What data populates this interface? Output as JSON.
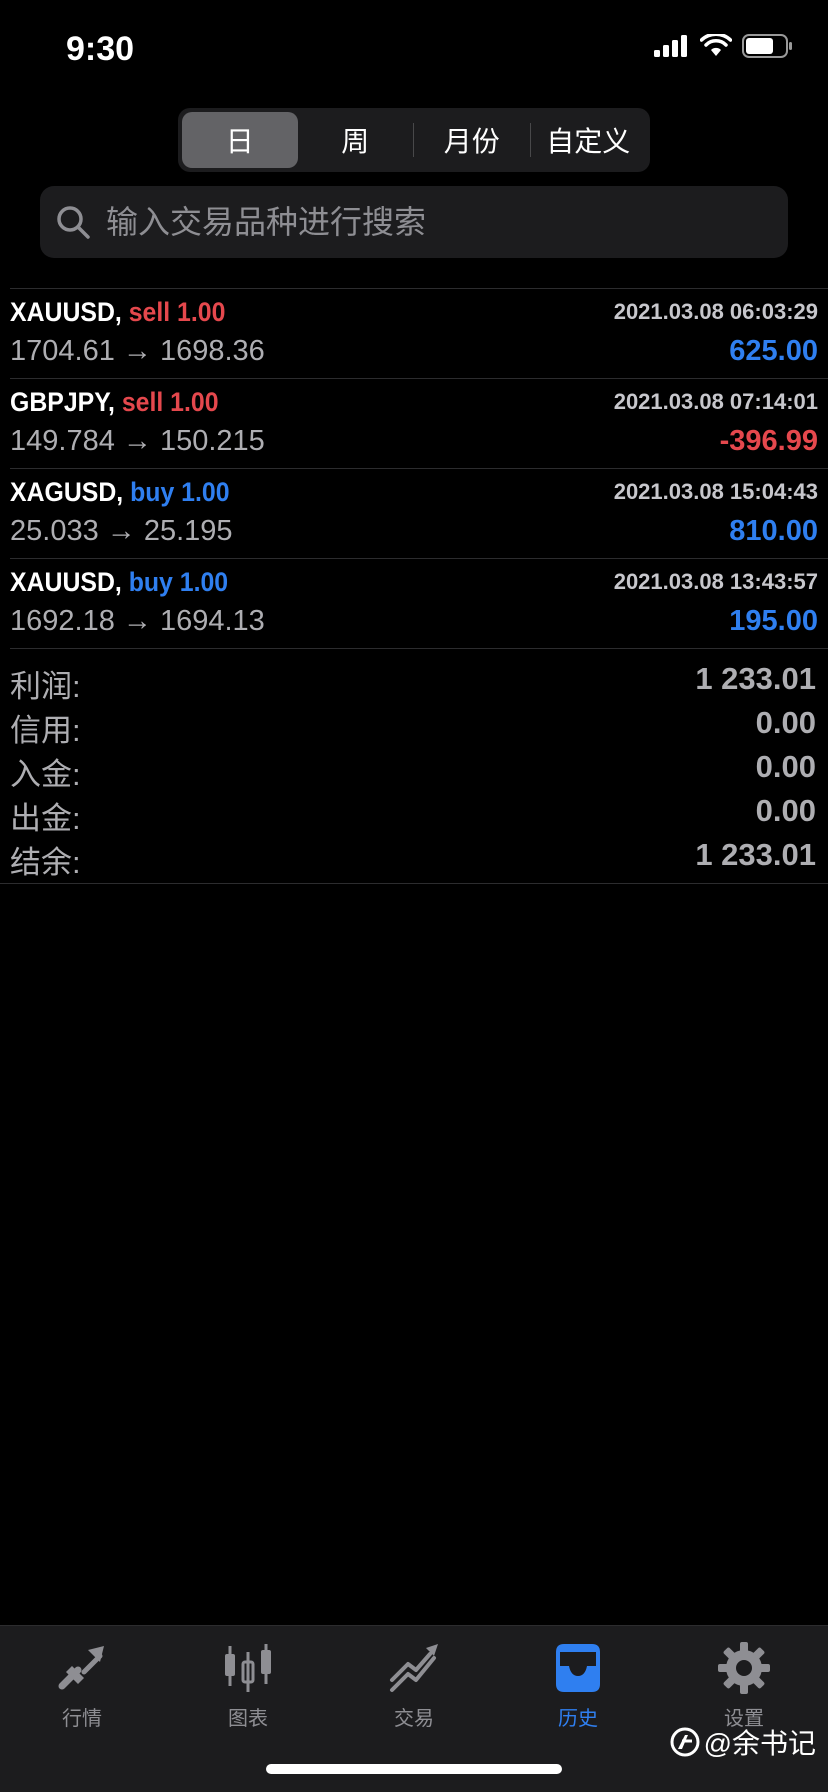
{
  "status_bar": {
    "time": "9:30"
  },
  "period_tabs": [
    {
      "label": "日",
      "active": true
    },
    {
      "label": "周",
      "active": false
    },
    {
      "label": "月份",
      "active": false
    },
    {
      "label": "自定义",
      "active": false
    }
  ],
  "search": {
    "placeholder": "输入交易品种进行搜索",
    "value": ""
  },
  "trades": [
    {
      "symbol": "XAUUSD,",
      "side": "sell 1.00",
      "direction": "sell",
      "time": "2021.03.08 06:03:29",
      "prices": "1704.61 → 1698.36",
      "profit": "625.00",
      "profit_sign": "pos"
    },
    {
      "symbol": "GBPJPY,",
      "side": "sell 1.00",
      "direction": "sell",
      "time": "2021.03.08 07:14:01",
      "prices": "149.784 → 150.215",
      "profit": "-396.99",
      "profit_sign": "neg"
    },
    {
      "symbol": "XAGUSD,",
      "side": "buy 1.00",
      "direction": "buy",
      "time": "2021.03.08 15:04:43",
      "prices": "25.033 → 25.195",
      "profit": "810.00",
      "profit_sign": "pos"
    },
    {
      "symbol": "XAUUSD,",
      "side": "buy 1.00",
      "direction": "buy",
      "time": "2021.03.08 13:43:57",
      "prices": "1692.18 → 1694.13",
      "profit": "195.00",
      "profit_sign": "pos"
    }
  ],
  "summary": [
    {
      "label": "利润:",
      "value": "1 233.01"
    },
    {
      "label": "信用:",
      "value": "0.00"
    },
    {
      "label": "入金:",
      "value": "0.00"
    },
    {
      "label": "出金:",
      "value": "0.00"
    },
    {
      "label": "结余:",
      "value": "1 233.01"
    }
  ],
  "tab_bar": [
    {
      "label": "行情",
      "icon": "quotes-icon",
      "active": false
    },
    {
      "label": "图表",
      "icon": "candlestick-chart-icon",
      "active": false
    },
    {
      "label": "交易",
      "icon": "trade-icon",
      "active": false
    },
    {
      "label": "历史",
      "icon": "history-inbox-icon",
      "active": true
    },
    {
      "label": "设置",
      "icon": "gear-icon",
      "active": false
    }
  ],
  "watermark": {
    "text": "@余书记",
    "icon": "toutiao-logo-icon"
  },
  "colors": {
    "sell": "#e5484d",
    "buy": "#2f7ff0",
    "active_tab": "#2f7ff0",
    "inactive": "#8e8e93"
  }
}
